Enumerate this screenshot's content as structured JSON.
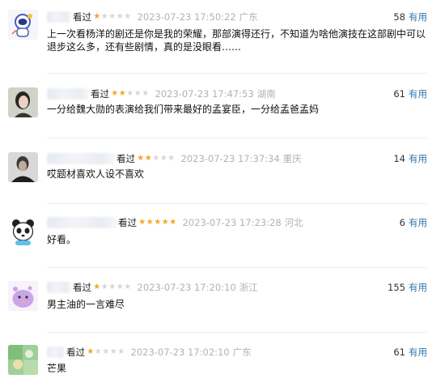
{
  "comments": [
    {
      "status": "看过",
      "rating": 1,
      "time": "2023-07-23 17:50:22",
      "location": "广东",
      "votes": "58",
      "vote_label": "有用",
      "text": "上一次看杨洋的剧还是你是我的荣耀，那部演得还行，不知道为啥他演技在这部剧中可以退步这么多，还有些剧情，真的是没眼看……"
    },
    {
      "status": "看过",
      "rating": 2,
      "time": "2023-07-23 17:47:53",
      "location": "湖南",
      "votes": "61",
      "vote_label": "有用",
      "text": "一分给魏大勋的表演给我们带来最好的孟宴臣，一分给孟爸孟妈"
    },
    {
      "status": "看过",
      "rating": 2,
      "time": "2023-07-23 17:37:34",
      "location": "重庆",
      "votes": "14",
      "vote_label": "有用",
      "text": "哎题材喜欢人设不喜欢"
    },
    {
      "status": "看过",
      "rating": 5,
      "time": "2023-07-23 17:23:28",
      "location": "河北",
      "votes": "6",
      "vote_label": "有用",
      "text": "好看。"
    },
    {
      "status": "看过",
      "rating": 1,
      "time": "2023-07-23 17:20:10",
      "location": "浙江",
      "votes": "155",
      "vote_label": "有用",
      "text": "男主油的一言难尽"
    },
    {
      "status": "看过",
      "rating": 1,
      "time": "2023-07-23 17:02:10",
      "location": "广东",
      "votes": "61",
      "vote_label": "有用",
      "text": "芒果"
    }
  ],
  "colors": {
    "star_on": "#f5a623",
    "star_off": "#d6d6d6",
    "meta_gray": "#b2b2b2",
    "link_blue": "#3377aa"
  },
  "icons": {
    "avatar_1": "astronaut-cartoon-avatar",
    "avatar_2": "woman-portrait-avatar",
    "avatar_3": "man-dark-portrait-avatar",
    "avatar_4": "panda-cartoon-avatar",
    "avatar_5": "purple-creature-avatar",
    "avatar_6": "green-blurred-avatar"
  }
}
